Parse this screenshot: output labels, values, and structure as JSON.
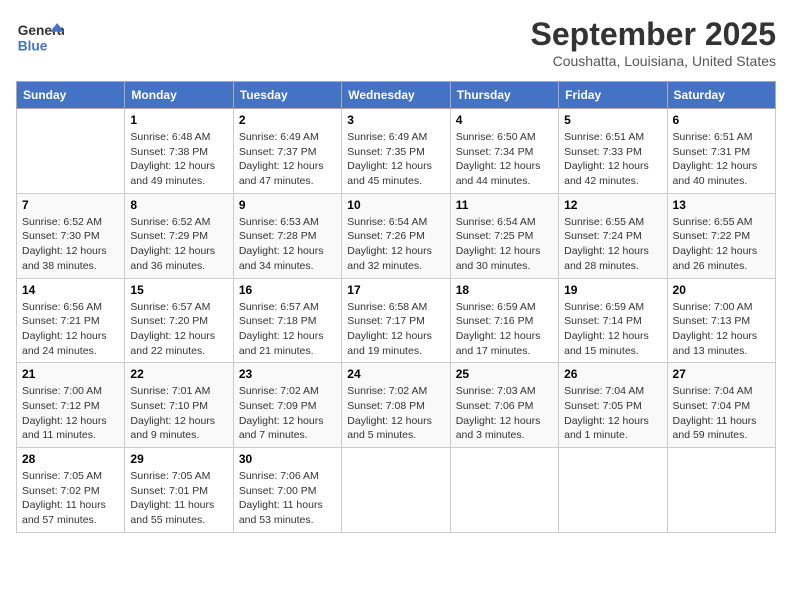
{
  "logo": {
    "general": "General",
    "blue": "Blue"
  },
  "header": {
    "month": "September 2025",
    "location": "Coushatta, Louisiana, United States"
  },
  "days_of_week": [
    "Sunday",
    "Monday",
    "Tuesday",
    "Wednesday",
    "Thursday",
    "Friday",
    "Saturday"
  ],
  "weeks": [
    [
      {
        "day": "",
        "sunrise": "",
        "sunset": "",
        "daylight": ""
      },
      {
        "day": "1",
        "sunrise": "Sunrise: 6:48 AM",
        "sunset": "Sunset: 7:38 PM",
        "daylight": "Daylight: 12 hours and 49 minutes."
      },
      {
        "day": "2",
        "sunrise": "Sunrise: 6:49 AM",
        "sunset": "Sunset: 7:37 PM",
        "daylight": "Daylight: 12 hours and 47 minutes."
      },
      {
        "day": "3",
        "sunrise": "Sunrise: 6:49 AM",
        "sunset": "Sunset: 7:35 PM",
        "daylight": "Daylight: 12 hours and 45 minutes."
      },
      {
        "day": "4",
        "sunrise": "Sunrise: 6:50 AM",
        "sunset": "Sunset: 7:34 PM",
        "daylight": "Daylight: 12 hours and 44 minutes."
      },
      {
        "day": "5",
        "sunrise": "Sunrise: 6:51 AM",
        "sunset": "Sunset: 7:33 PM",
        "daylight": "Daylight: 12 hours and 42 minutes."
      },
      {
        "day": "6",
        "sunrise": "Sunrise: 6:51 AM",
        "sunset": "Sunset: 7:31 PM",
        "daylight": "Daylight: 12 hours and 40 minutes."
      }
    ],
    [
      {
        "day": "7",
        "sunrise": "Sunrise: 6:52 AM",
        "sunset": "Sunset: 7:30 PM",
        "daylight": "Daylight: 12 hours and 38 minutes."
      },
      {
        "day": "8",
        "sunrise": "Sunrise: 6:52 AM",
        "sunset": "Sunset: 7:29 PM",
        "daylight": "Daylight: 12 hours and 36 minutes."
      },
      {
        "day": "9",
        "sunrise": "Sunrise: 6:53 AM",
        "sunset": "Sunset: 7:28 PM",
        "daylight": "Daylight: 12 hours and 34 minutes."
      },
      {
        "day": "10",
        "sunrise": "Sunrise: 6:54 AM",
        "sunset": "Sunset: 7:26 PM",
        "daylight": "Daylight: 12 hours and 32 minutes."
      },
      {
        "day": "11",
        "sunrise": "Sunrise: 6:54 AM",
        "sunset": "Sunset: 7:25 PM",
        "daylight": "Daylight: 12 hours and 30 minutes."
      },
      {
        "day": "12",
        "sunrise": "Sunrise: 6:55 AM",
        "sunset": "Sunset: 7:24 PM",
        "daylight": "Daylight: 12 hours and 28 minutes."
      },
      {
        "day": "13",
        "sunrise": "Sunrise: 6:55 AM",
        "sunset": "Sunset: 7:22 PM",
        "daylight": "Daylight: 12 hours and 26 minutes."
      }
    ],
    [
      {
        "day": "14",
        "sunrise": "Sunrise: 6:56 AM",
        "sunset": "Sunset: 7:21 PM",
        "daylight": "Daylight: 12 hours and 24 minutes."
      },
      {
        "day": "15",
        "sunrise": "Sunrise: 6:57 AM",
        "sunset": "Sunset: 7:20 PM",
        "daylight": "Daylight: 12 hours and 22 minutes."
      },
      {
        "day": "16",
        "sunrise": "Sunrise: 6:57 AM",
        "sunset": "Sunset: 7:18 PM",
        "daylight": "Daylight: 12 hours and 21 minutes."
      },
      {
        "day": "17",
        "sunrise": "Sunrise: 6:58 AM",
        "sunset": "Sunset: 7:17 PM",
        "daylight": "Daylight: 12 hours and 19 minutes."
      },
      {
        "day": "18",
        "sunrise": "Sunrise: 6:59 AM",
        "sunset": "Sunset: 7:16 PM",
        "daylight": "Daylight: 12 hours and 17 minutes."
      },
      {
        "day": "19",
        "sunrise": "Sunrise: 6:59 AM",
        "sunset": "Sunset: 7:14 PM",
        "daylight": "Daylight: 12 hours and 15 minutes."
      },
      {
        "day": "20",
        "sunrise": "Sunrise: 7:00 AM",
        "sunset": "Sunset: 7:13 PM",
        "daylight": "Daylight: 12 hours and 13 minutes."
      }
    ],
    [
      {
        "day": "21",
        "sunrise": "Sunrise: 7:00 AM",
        "sunset": "Sunset: 7:12 PM",
        "daylight": "Daylight: 12 hours and 11 minutes."
      },
      {
        "day": "22",
        "sunrise": "Sunrise: 7:01 AM",
        "sunset": "Sunset: 7:10 PM",
        "daylight": "Daylight: 12 hours and 9 minutes."
      },
      {
        "day": "23",
        "sunrise": "Sunrise: 7:02 AM",
        "sunset": "Sunset: 7:09 PM",
        "daylight": "Daylight: 12 hours and 7 minutes."
      },
      {
        "day": "24",
        "sunrise": "Sunrise: 7:02 AM",
        "sunset": "Sunset: 7:08 PM",
        "daylight": "Daylight: 12 hours and 5 minutes."
      },
      {
        "day": "25",
        "sunrise": "Sunrise: 7:03 AM",
        "sunset": "Sunset: 7:06 PM",
        "daylight": "Daylight: 12 hours and 3 minutes."
      },
      {
        "day": "26",
        "sunrise": "Sunrise: 7:04 AM",
        "sunset": "Sunset: 7:05 PM",
        "daylight": "Daylight: 12 hours and 1 minute."
      },
      {
        "day": "27",
        "sunrise": "Sunrise: 7:04 AM",
        "sunset": "Sunset: 7:04 PM",
        "daylight": "Daylight: 11 hours and 59 minutes."
      }
    ],
    [
      {
        "day": "28",
        "sunrise": "Sunrise: 7:05 AM",
        "sunset": "Sunset: 7:02 PM",
        "daylight": "Daylight: 11 hours and 57 minutes."
      },
      {
        "day": "29",
        "sunrise": "Sunrise: 7:05 AM",
        "sunset": "Sunset: 7:01 PM",
        "daylight": "Daylight: 11 hours and 55 minutes."
      },
      {
        "day": "30",
        "sunrise": "Sunrise: 7:06 AM",
        "sunset": "Sunset: 7:00 PM",
        "daylight": "Daylight: 11 hours and 53 minutes."
      },
      {
        "day": "",
        "sunrise": "",
        "sunset": "",
        "daylight": ""
      },
      {
        "day": "",
        "sunrise": "",
        "sunset": "",
        "daylight": ""
      },
      {
        "day": "",
        "sunrise": "",
        "sunset": "",
        "daylight": ""
      },
      {
        "day": "",
        "sunrise": "",
        "sunset": "",
        "daylight": ""
      }
    ]
  ]
}
